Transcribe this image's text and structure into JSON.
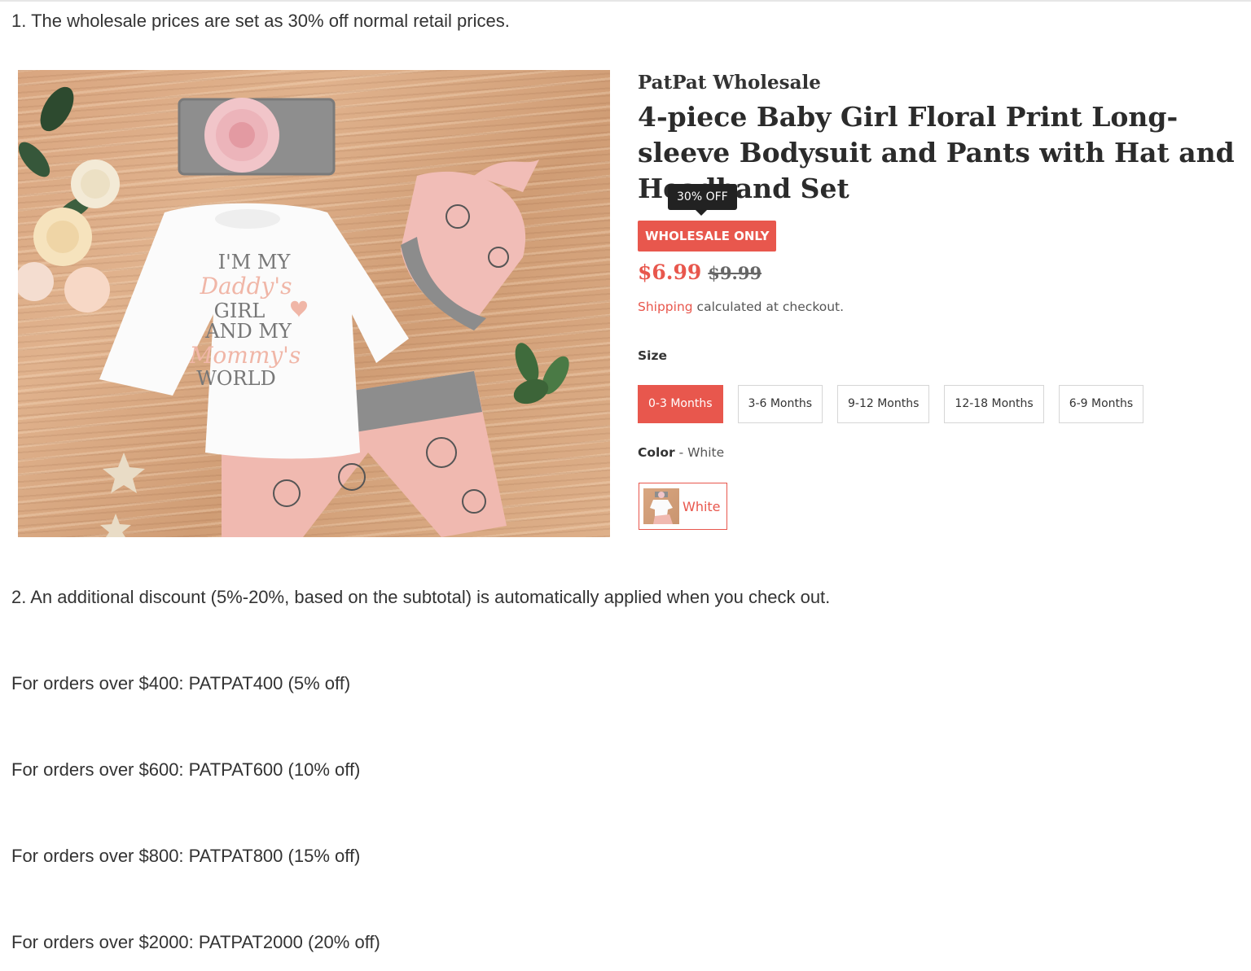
{
  "intro": {
    "point1": "1. The wholesale prices are set as 30% off normal retail prices.",
    "point2": "2. An additional discount (5%-20%, based on the subtotal) is automatically applied when you check out."
  },
  "product": {
    "vendor": "PatPat Wholesale",
    "title": "4-piece Baby Girl Floral Print Long-sleeve Bodysuit and Pants with Hat and Headband Set",
    "discount_tooltip": "30% OFF",
    "badge": "WHOLESALE ONLY",
    "price": "$6.99",
    "compare_price": "$9.99",
    "shipping_link": "Shipping",
    "shipping_text": " calculated at checkout.",
    "image": {
      "onesie_lines": [
        "I'M MY",
        "Daddy's",
        "GIRL",
        "AND MY",
        "Mommy's",
        "WORLD"
      ]
    },
    "size": {
      "label": "Size",
      "options": [
        "0-3 Months",
        "3-6 Months",
        "9-12 Months",
        "12-18 Months",
        "6-9 Months"
      ],
      "selected": "0-3 Months"
    },
    "color": {
      "label": "Color",
      "separator": " - ",
      "value": "White",
      "swatch_label": "White"
    }
  },
  "discount_tiers": [
    "For orders over $400: PATPAT400 (5% off)",
    "For orders over $600: PATPAT600 (10% off)",
    "For orders over $800: PATPAT800 (15% off)",
    "For orders over $2000: PATPAT2000 (20% off)"
  ],
  "colors": {
    "accent": "#e8574d",
    "text": "#333333",
    "tooltip_bg": "#222222"
  }
}
